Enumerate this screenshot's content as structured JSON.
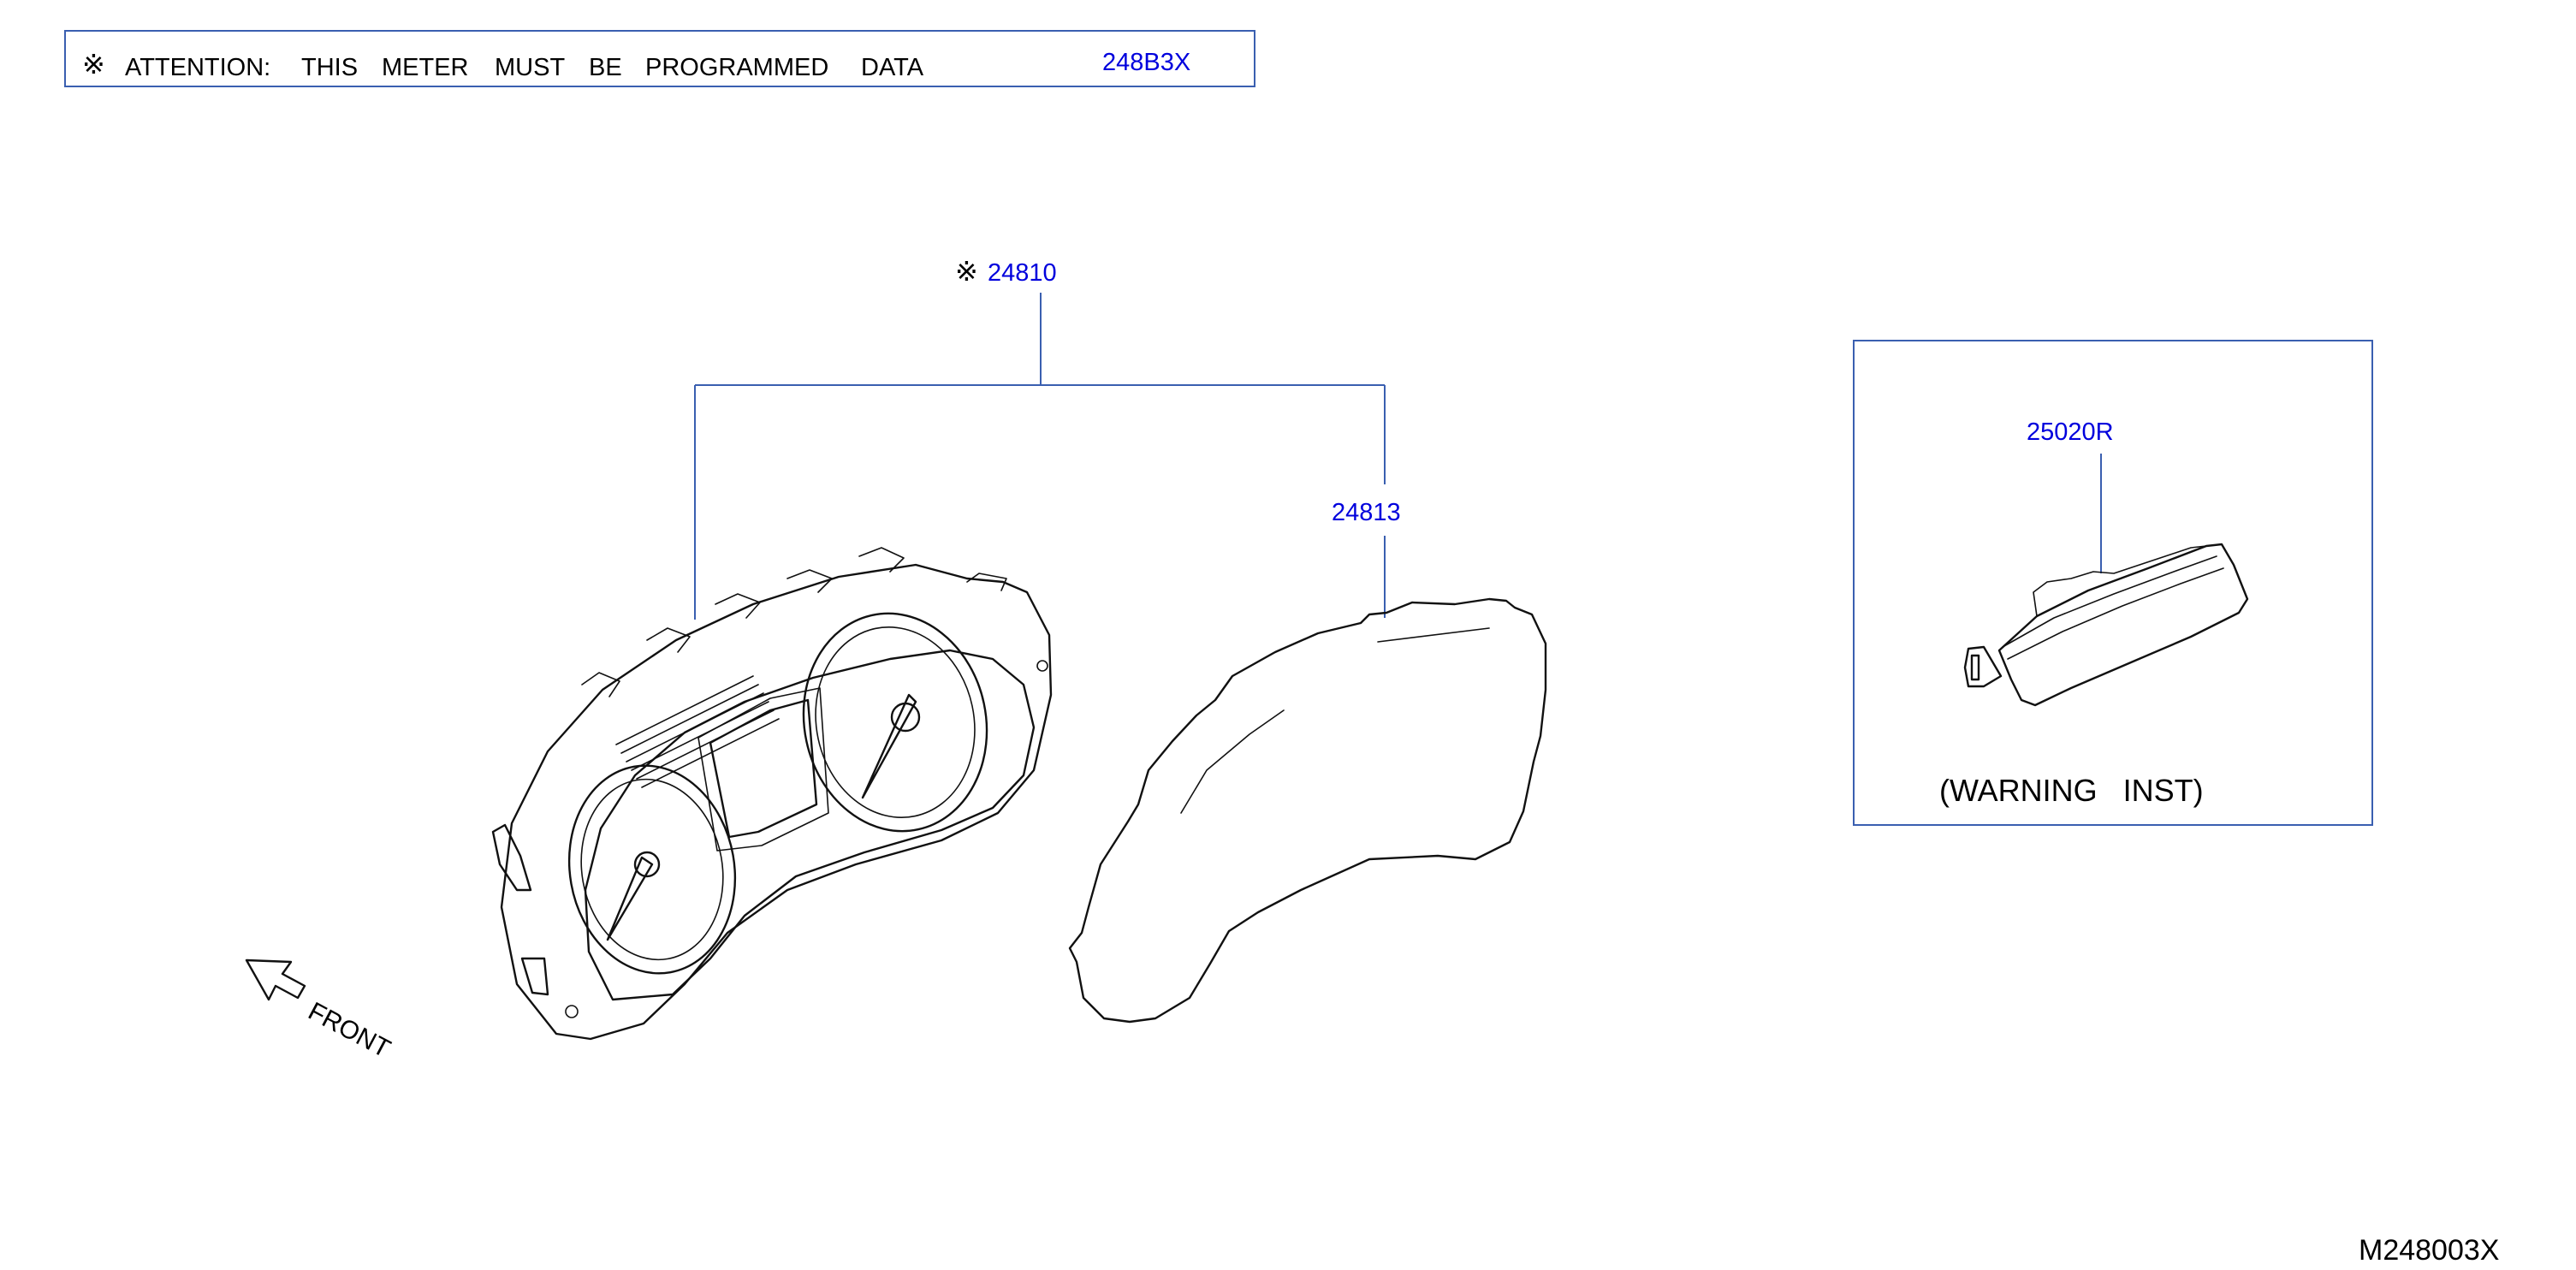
{
  "colors": {
    "callout_blue": "#0000dd",
    "frame_blue": "#3a5fb0",
    "line_black": "#111111"
  },
  "notice": {
    "symbol": "※",
    "words": [
      "ATTENTION:",
      "THIS",
      "METER",
      "MUST",
      "BE",
      "PROGRAMMED",
      "DATA"
    ],
    "part_number": "248B3X"
  },
  "callouts": {
    "main_assembly": {
      "symbol": "※",
      "part_number": "24810"
    },
    "lens_cover": {
      "part_number": "24813"
    },
    "warning_unit": {
      "part_number": "25020R"
    }
  },
  "warning_box": {
    "caption": "(WARNING   INST)"
  },
  "front_indicator": {
    "label": "FRONT",
    "icon": "front-direction-arrow-icon"
  },
  "diagram_id": "M248003X"
}
